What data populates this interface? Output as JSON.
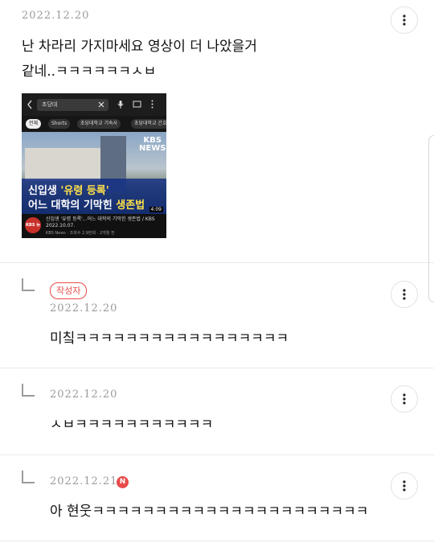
{
  "comments": [
    {
      "date": "2022.12.20",
      "lines": [
        "난 차라리 가지마세요 영상이 더 나았을거",
        "같네..ㅋㅋㅋㅋㅋㅋㅅㅂ"
      ],
      "image": {
        "search_text": "초당대",
        "chips": [
          "전체",
          "Shorts",
          "초당대학교 기숙사",
          "초당대학교 간호"
        ],
        "brand": "KBS NEWS",
        "title_line1_a": "신입생 ",
        "title_line1_b": "'유령 등록'",
        "title_line2_a": "어느 대학의 기막힌 ",
        "title_line2_b": "생존법",
        "duration": "4:09",
        "channel_logo": "KBS 뉴스",
        "video_title": "신입생 '유령 등록'...어느 대학의 기막힌 생존법 / KBS  2022.10.07.",
        "video_sub": "KBS News · 조회수 2.9만회 · 2개월 전"
      }
    },
    {
      "badge": "작성자",
      "date": "2022.12.20",
      "text": "미칰ㅋㅋㅋㅋㅋㅋㅋㅋㅋㅋㅋㅋㅋㅋㅋㅋㅋ"
    },
    {
      "date": "2022.12.20",
      "text": "ㅅㅂㅋㅋㅋㅋㅋㅋㅋㅋㅋㅋㅋ"
    },
    {
      "date": "2022.12.21",
      "new_badge": "N",
      "text": "아 현웃ㅋㅋㅋㅋㅋㅋㅋㅋㅋㅋㅋㅋㅋㅋㅋㅋㅋㅋㅋㅋㅋㅋ"
    }
  ],
  "icons": {
    "more": "more-vertical-icon",
    "reply": "reply-arrow-icon",
    "back": "back-arrow-icon",
    "clear": "close-icon",
    "mic": "mic-icon",
    "cast": "cast-icon"
  },
  "colors": {
    "accent_red": "#e84a4a",
    "date_gray": "#9a9a9a",
    "divider": "#e9e9e9"
  }
}
